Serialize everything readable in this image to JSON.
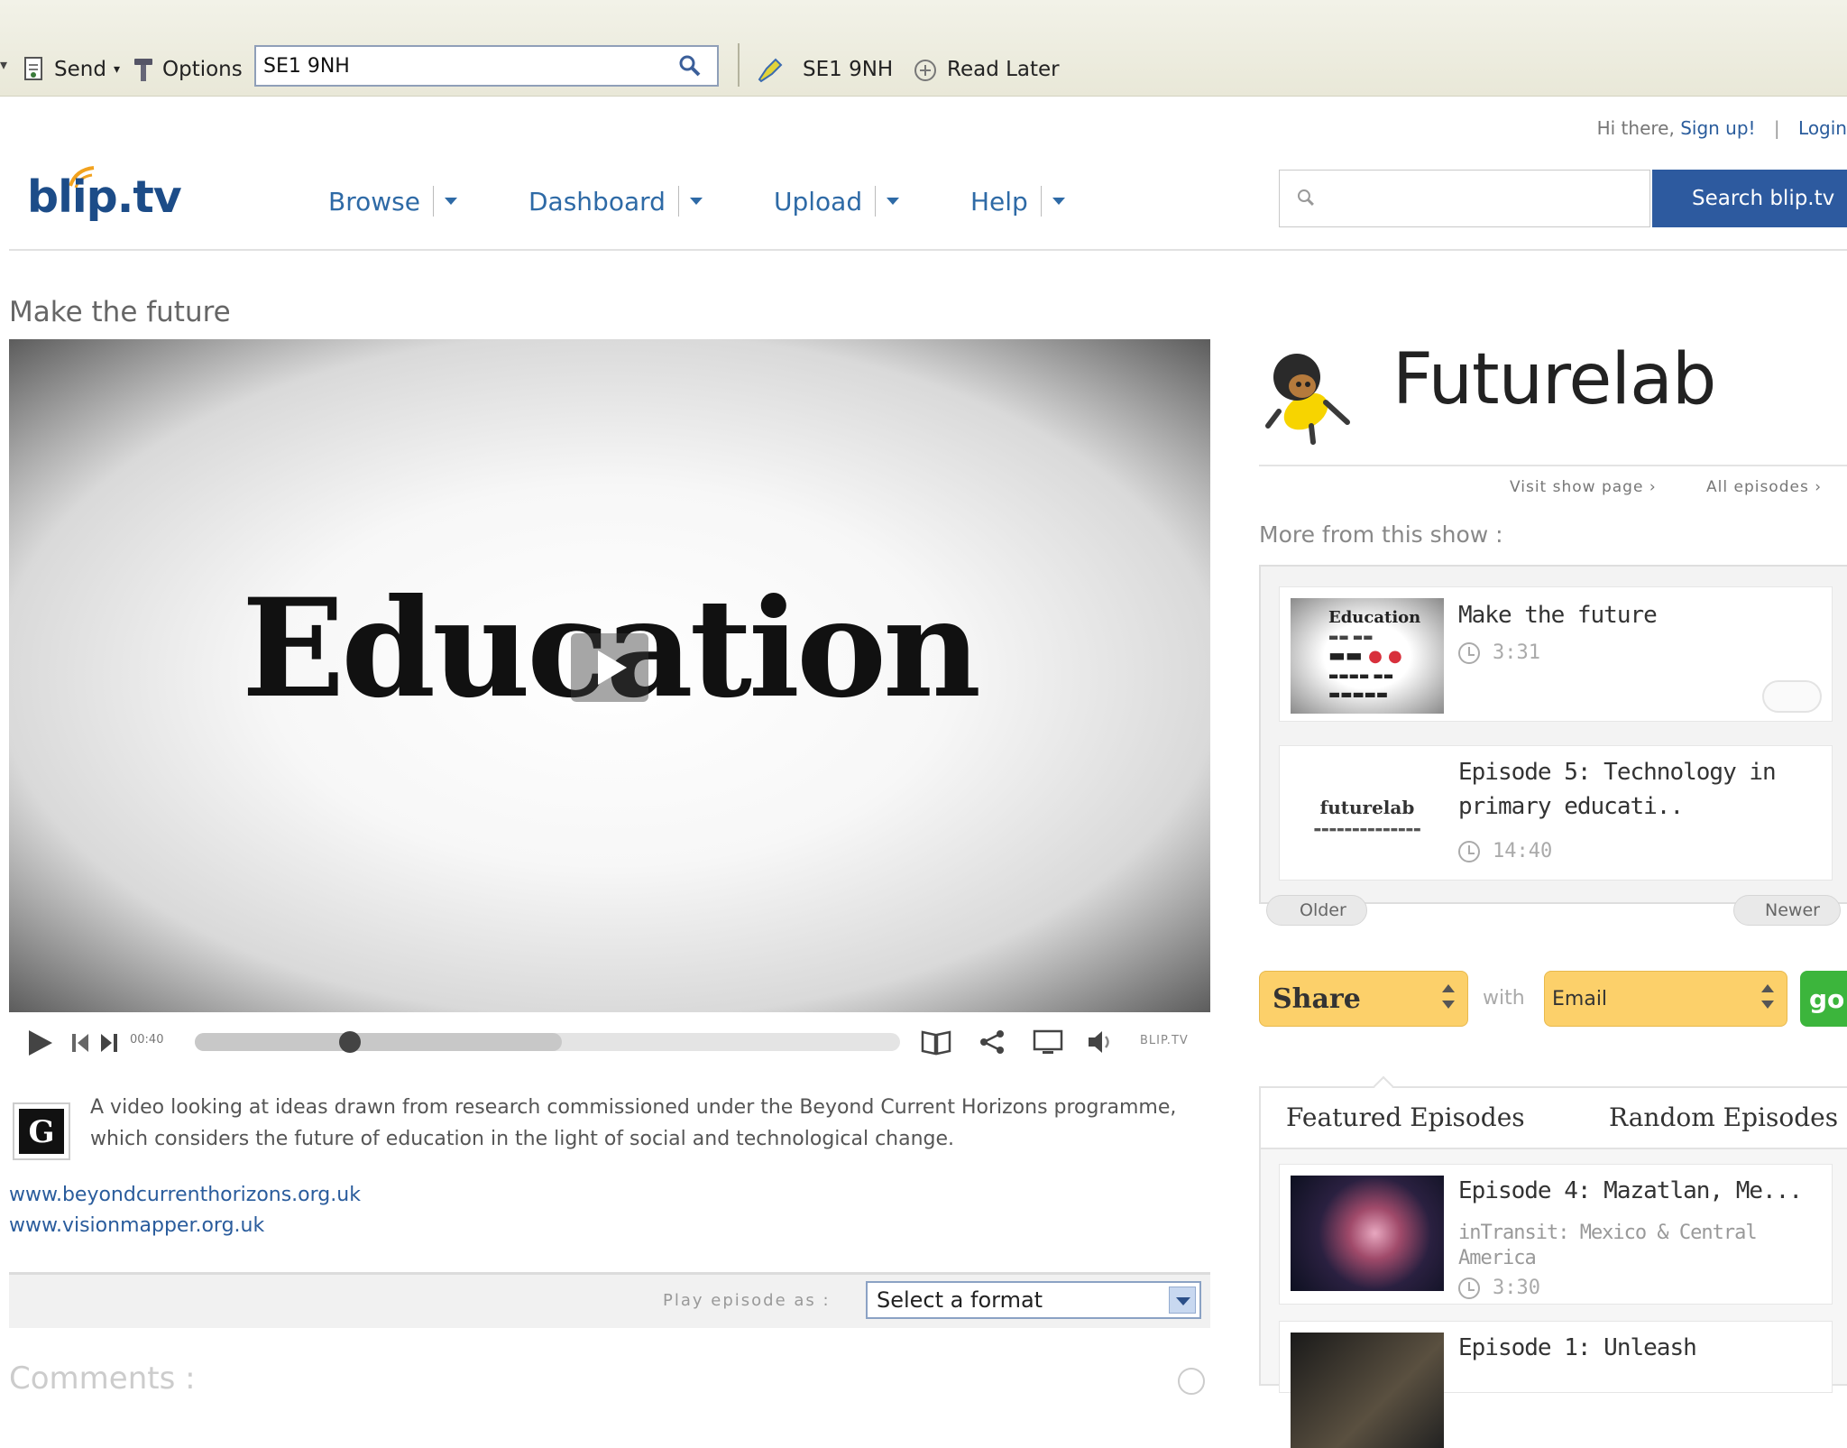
{
  "toolbar": {
    "send_label": "Send",
    "options_label": "Options",
    "search_value": "SE1 9NH",
    "location_text": "SE1  9NH",
    "read_later_label": "Read Later"
  },
  "header": {
    "greeting": "Hi there,",
    "signup_label": "Sign up!",
    "separator": "|",
    "login_label": "Login",
    "logo": "blip.tv",
    "nav": [
      "Browse",
      "Dashboard",
      "Upload",
      "Help"
    ],
    "search_placeholder": "",
    "search_button": "Search blip.tv"
  },
  "video": {
    "title": "Make the future",
    "frame_text": "Education",
    "time": "00:40",
    "progress": 0.22,
    "buffered": 0.52,
    "brand": "BLIP.TV",
    "description": "A video looking at ideas drawn from research commissioned under the Beyond Current Horizons programme, which considers the future of education in the light of social and technological change.",
    "links": [
      "www.beyondcurrenthorizons.org.uk",
      "www.visionmapper.org.uk"
    ],
    "play_as_label": "Play episode as :",
    "format_value": "Select a format",
    "comments_label": "Comments :"
  },
  "show": {
    "name": "Futurelab",
    "visit_link": "Visit show page ›",
    "all_link": "All episodes ›",
    "more_label": "More from this show :",
    "episodes": [
      {
        "title": "Make the future",
        "duration": "3:31"
      },
      {
        "title": "Episode 5: Technology in primary educati..",
        "duration": "14:40"
      }
    ],
    "older_label": "Older",
    "newer_label": "Newer",
    "thumb1_text": "Education",
    "thumb2_text": "futurelab"
  },
  "share": {
    "share_label": "Share",
    "with_label": "with",
    "method_value": "Email",
    "go_label": "go!"
  },
  "featured": {
    "tabs": [
      "Featured Episodes",
      "Random Episodes"
    ],
    "episodes": [
      {
        "title": "Episode 4: Mazatlan, Me...",
        "show": "inTransit: Mexico & Central America",
        "duration": "3:30"
      },
      {
        "title": "Episode 1: Unleash"
      }
    ]
  },
  "colors": {
    "brand_blue": "#2d5a9f",
    "link_blue": "#2e6aa6",
    "share_yellow": "#fcd06a",
    "go_green": "#3cb53c"
  }
}
